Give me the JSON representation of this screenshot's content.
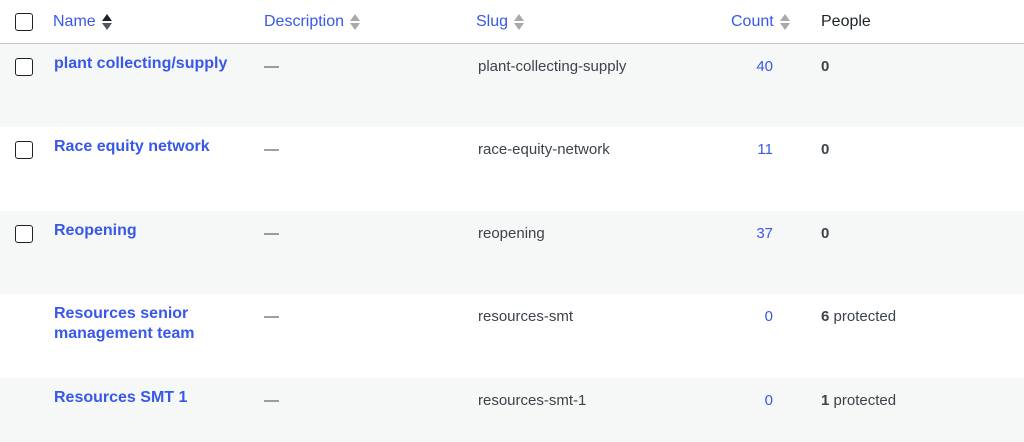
{
  "columns": {
    "name": "Name",
    "description": "Description",
    "slug": "Slug",
    "count": "Count",
    "people": "People"
  },
  "rows": [
    {
      "name": "plant collecting/supply",
      "description": "—",
      "slug": "plant-collecting-supply",
      "count": "40",
      "people_num": "0",
      "people_suffix": "",
      "checkbox": true
    },
    {
      "name": "Race equity network",
      "description": "—",
      "slug": "race-equity-network",
      "count": "11",
      "people_num": "0",
      "people_suffix": "",
      "checkbox": true
    },
    {
      "name": "Reopening",
      "description": "—",
      "slug": "reopening",
      "count": "37",
      "people_num": "0",
      "people_suffix": "",
      "checkbox": true
    },
    {
      "name": "Resources senior management team",
      "description": "—",
      "slug": "resources-smt",
      "count": "0",
      "people_num": "6",
      "people_suffix": " protected",
      "checkbox": false
    },
    {
      "name": "Resources SMT 1",
      "description": "—",
      "slug": "resources-smt-1",
      "count": "0",
      "people_num": "1",
      "people_suffix": " protected",
      "checkbox": false
    }
  ],
  "colors": {
    "link": "#3858e9",
    "alt_row": "#f6f7f7",
    "text": "#3c434a"
  }
}
